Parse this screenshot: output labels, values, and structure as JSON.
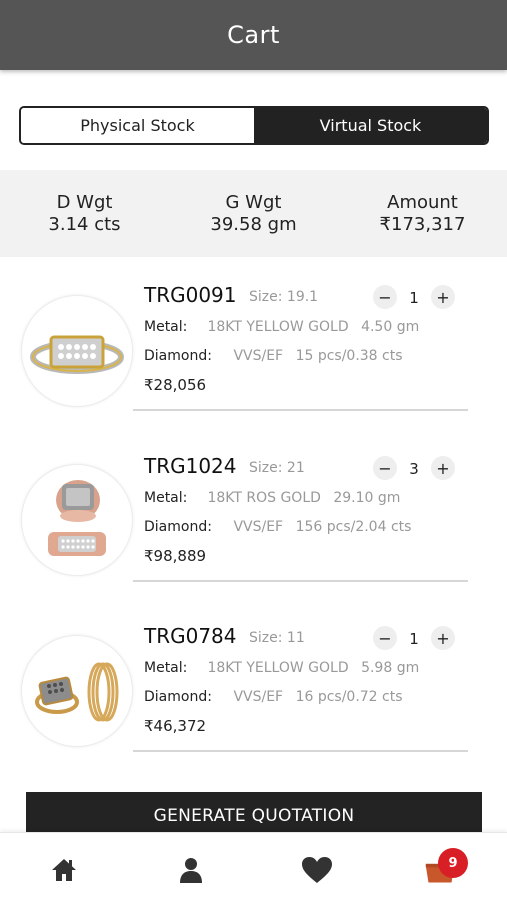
{
  "header": {
    "title": "Cart"
  },
  "segment": {
    "physical_label": "Physical Stock",
    "virtual_label": "Virtual Stock",
    "active": "Virtual Stock"
  },
  "summary": {
    "d_wgt_label": "D Wgt",
    "d_wgt_value": "3.14 cts",
    "g_wgt_label": "G Wgt",
    "g_wgt_value": "39.58 gm",
    "amount_label": "Amount",
    "amount_value": "₹173,317"
  },
  "labels": {
    "size": "Size:",
    "metal": "Metal:",
    "diamond": "Diamond:"
  },
  "items": [
    {
      "code": "TRG0091",
      "size": "19.1",
      "qty": "1",
      "metal": "18KT YELLOW GOLD",
      "metal_weight": "4.50 gm",
      "diamond": "VVS/EF",
      "diamond_detail": "15 pcs/0.38 cts",
      "price": "₹28,056"
    },
    {
      "code": "TRG1024",
      "size": "21",
      "qty": "3",
      "metal": "18KT ROS GOLD",
      "metal_weight": "29.10 gm",
      "diamond": "VVS/EF",
      "diamond_detail": "156 pcs/2.04 cts",
      "price": "₹98,889"
    },
    {
      "code": "TRG0784",
      "size": "11",
      "qty": "1",
      "metal": "18KT YELLOW GOLD",
      "metal_weight": "5.98 gm",
      "diamond": "VVS/EF",
      "diamond_detail": "16 pcs/0.72 cts",
      "price": "₹46,372"
    }
  ],
  "qty_controls": {
    "minus": "−",
    "plus": "+"
  },
  "cta": {
    "label": "GENERATE QUOTATION"
  },
  "tabbar": {
    "items": [
      "home-icon",
      "user-icon",
      "heart-icon",
      "cart-icon"
    ],
    "cart_badge": "9",
    "active_color": "#c9572c"
  }
}
